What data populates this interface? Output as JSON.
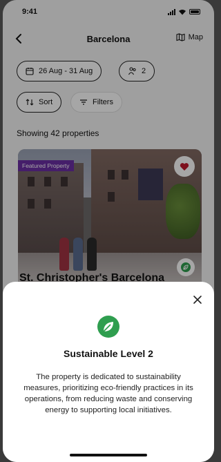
{
  "status_bar": {
    "time": "9:41"
  },
  "navbar": {
    "title": "Barcelona",
    "map_label": "Map"
  },
  "filters": {
    "dates": "26 Aug - 31 Aug",
    "guests": "2",
    "sort_label": "Sort",
    "filters_label": "Filters"
  },
  "results": {
    "showing": "Showing 42 properties"
  },
  "property": {
    "badge": "Featured Property",
    "name": "St. Christopher's Barcelona"
  },
  "sheet": {
    "title": "Sustainable Level 2",
    "body": "The property is dedicated to sustainability measures, prioritizing eco-friendly practices in its operations, from reducing waste and conserving energy to supporting local initiatives."
  },
  "colors": {
    "featured_badge": "#6b2fa3",
    "heart": "#c0182c",
    "eco_green": "#2f9e4f"
  }
}
